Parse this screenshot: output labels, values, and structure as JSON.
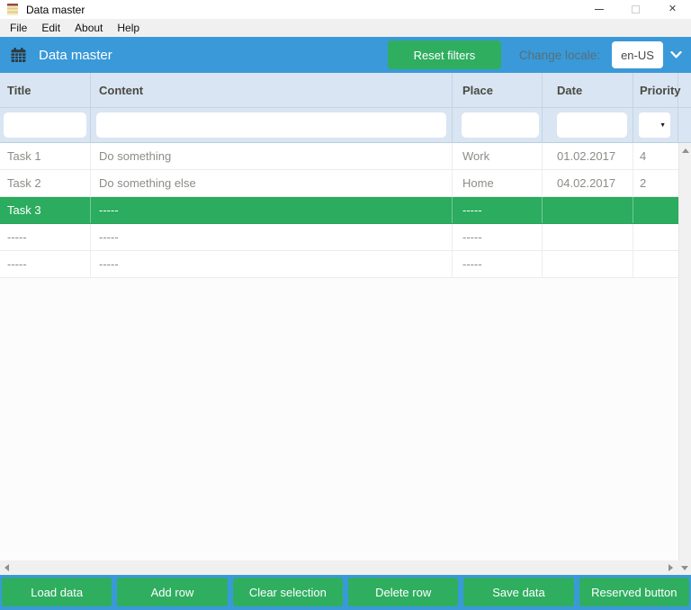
{
  "titlebar": {
    "title": "Data master"
  },
  "icons": {
    "close": "✕",
    "select_arrow": "▼"
  },
  "menu": {
    "items": [
      "File",
      "Edit",
      "About",
      "Help"
    ]
  },
  "header": {
    "title": "Data master",
    "reset_button_label": "Reset filters",
    "locale_label": "Change locale:",
    "locale_value": "en-US"
  },
  "table": {
    "columns": [
      "Title",
      "Content",
      "Place",
      "Date",
      "Priority"
    ],
    "rows": [
      {
        "title": "Task 1",
        "content": "Do something",
        "place": "Work",
        "date": "01.02.2017",
        "priority": "4",
        "selected": false
      },
      {
        "title": "Task 2",
        "content": "Do something else",
        "place": "Home",
        "date": "04.02.2017",
        "priority": "2",
        "selected": false
      },
      {
        "title": "Task 3",
        "content": "-----",
        "place": "-----",
        "date": "",
        "priority": "",
        "selected": true
      },
      {
        "title": "-----",
        "content": "-----",
        "place": "-----",
        "date": "",
        "priority": "",
        "selected": false
      },
      {
        "title": "-----",
        "content": "-----",
        "place": "-----",
        "date": "",
        "priority": "",
        "selected": false
      }
    ]
  },
  "footer": {
    "buttons": [
      "Load data",
      "Add row",
      "Clear selection",
      "Delete row",
      "Save data",
      "Reserved button"
    ]
  },
  "colors": {
    "accent_blue": "#3a99d8",
    "button_green": "#2fae60",
    "selected_row_green": "#2bac5e",
    "table_header_bg": "#d9e5f2"
  }
}
